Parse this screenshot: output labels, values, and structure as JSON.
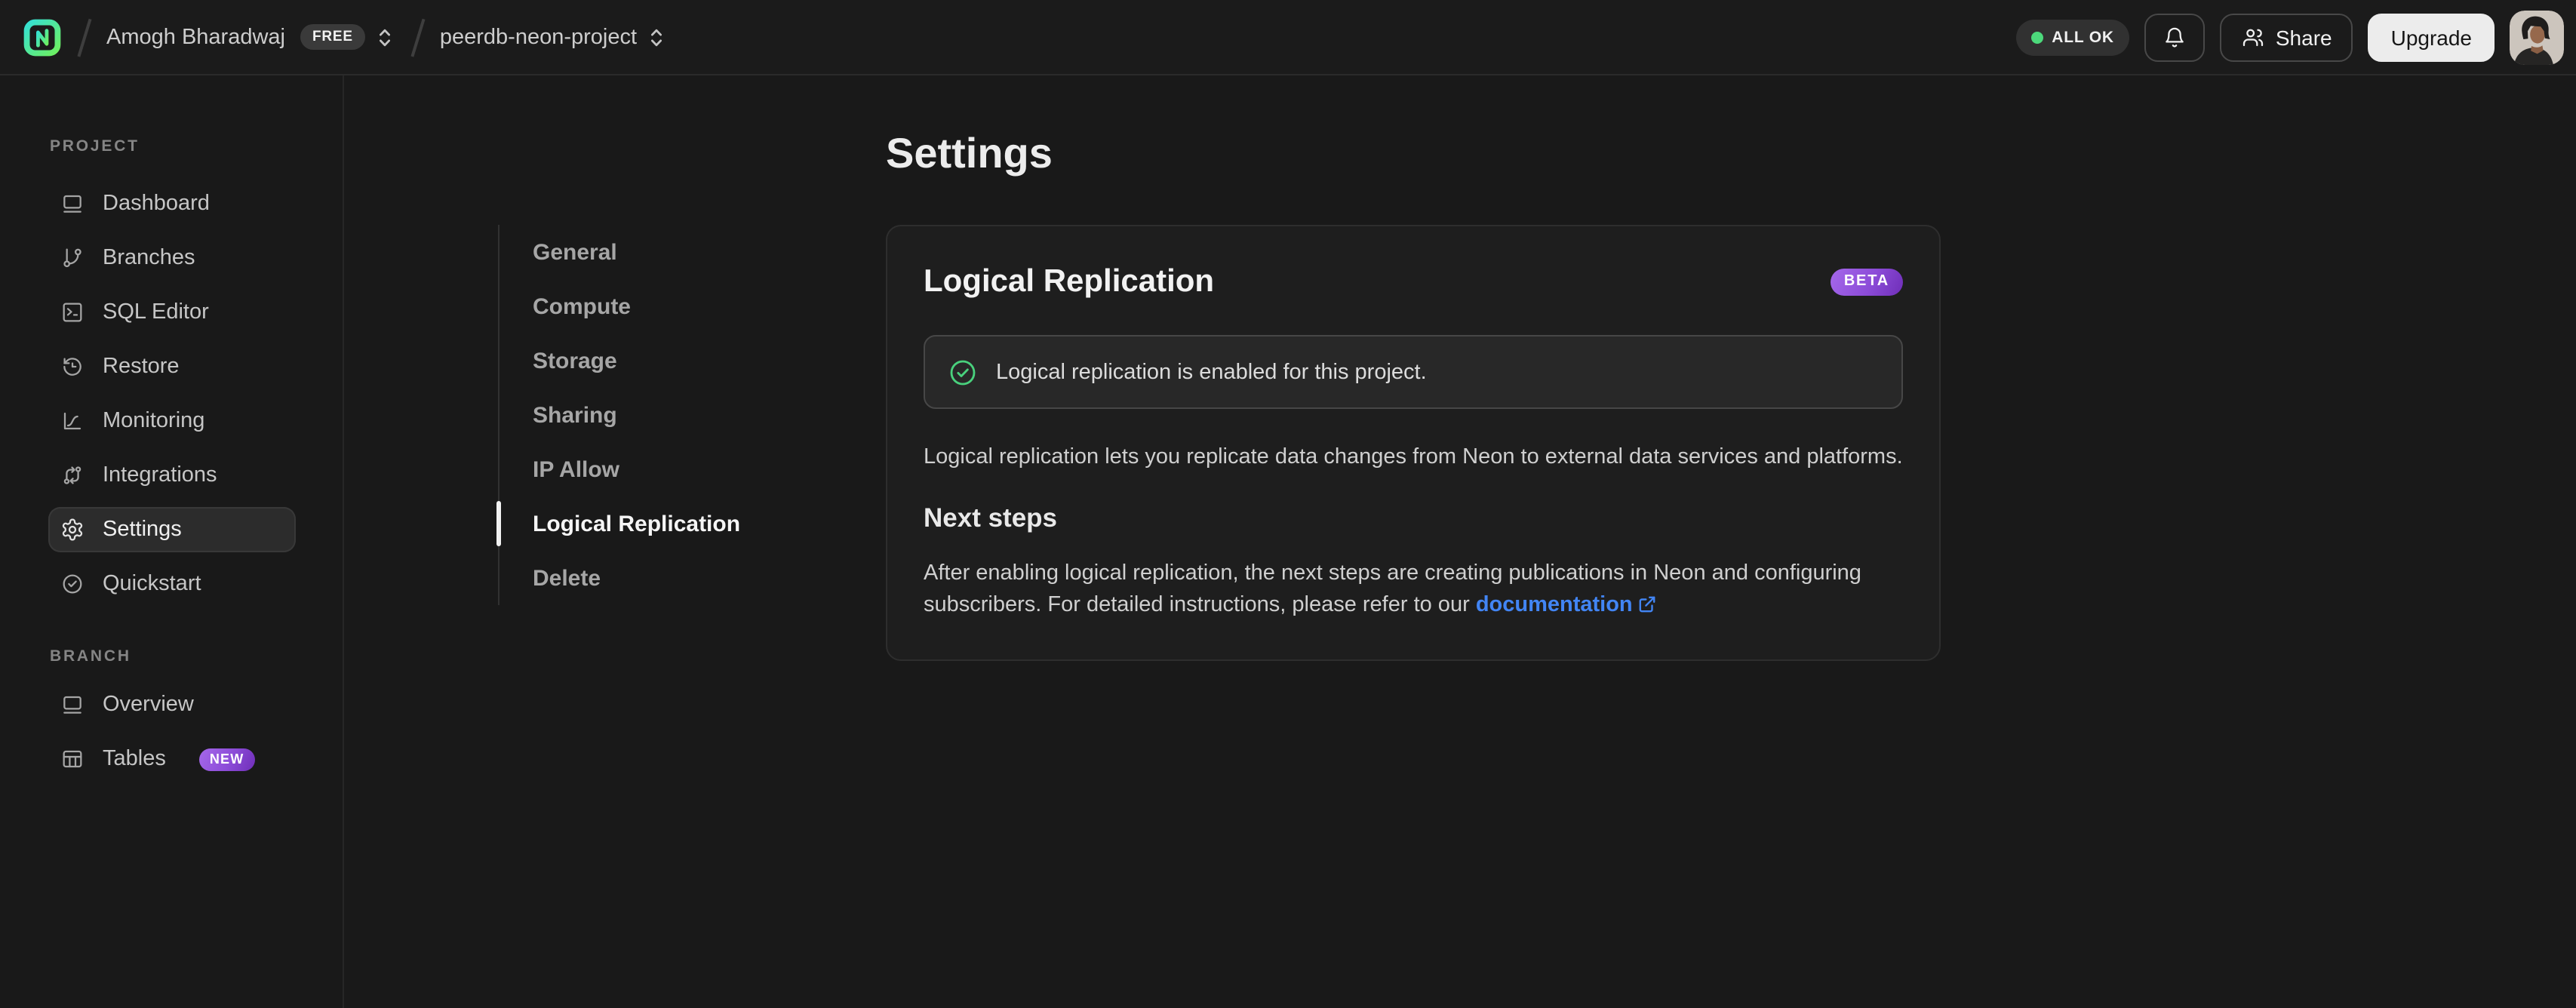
{
  "header": {
    "org_name": "Amogh Bharadwaj",
    "org_plan_badge": "FREE",
    "project_name": "peerdb-neon-project",
    "status_badge": "ALL OK",
    "share_label": "Share",
    "upgrade_label": "Upgrade"
  },
  "sidebar": {
    "sections": [
      {
        "label": "PROJECT",
        "items": [
          {
            "label": "Dashboard"
          },
          {
            "label": "Branches"
          },
          {
            "label": "SQL Editor"
          },
          {
            "label": "Restore"
          },
          {
            "label": "Monitoring"
          },
          {
            "label": "Integrations"
          },
          {
            "label": "Settings",
            "active": true
          },
          {
            "label": "Quickstart"
          }
        ]
      },
      {
        "label": "BRANCH",
        "items": [
          {
            "label": "Overview"
          },
          {
            "label": "Tables",
            "badge": "NEW"
          }
        ]
      }
    ]
  },
  "settings_nav": {
    "items": [
      {
        "label": "General"
      },
      {
        "label": "Compute"
      },
      {
        "label": "Storage"
      },
      {
        "label": "Sharing"
      },
      {
        "label": "IP Allow"
      },
      {
        "label": "Logical Replication",
        "active": true
      },
      {
        "label": "Delete"
      }
    ]
  },
  "main": {
    "page_title": "Settings",
    "card": {
      "title": "Logical Replication",
      "beta_badge": "BETA",
      "alert_text": "Logical replication is enabled for this project.",
      "description": "Logical replication lets you replicate data changes from Neon to external data services and platforms.",
      "next_steps_title": "Next steps",
      "next_steps_text": "After enabling logical replication, the next steps are creating publications in Neon and configuring subscribers. For detailed instructions, please refer to our ",
      "doc_link_label": "documentation"
    }
  },
  "colors": {
    "background": "#191919",
    "card_background": "#1e1e1e",
    "accent_logo_teal": "#35e0d4",
    "accent_logo_green": "#6ef05f",
    "status_dot_green": "#4cd97b",
    "success_check_green": "#49d17d",
    "badge_purple_light": "#a568ea",
    "badge_purple_dark": "#6f2eb8",
    "link_blue": "#4285f4"
  }
}
